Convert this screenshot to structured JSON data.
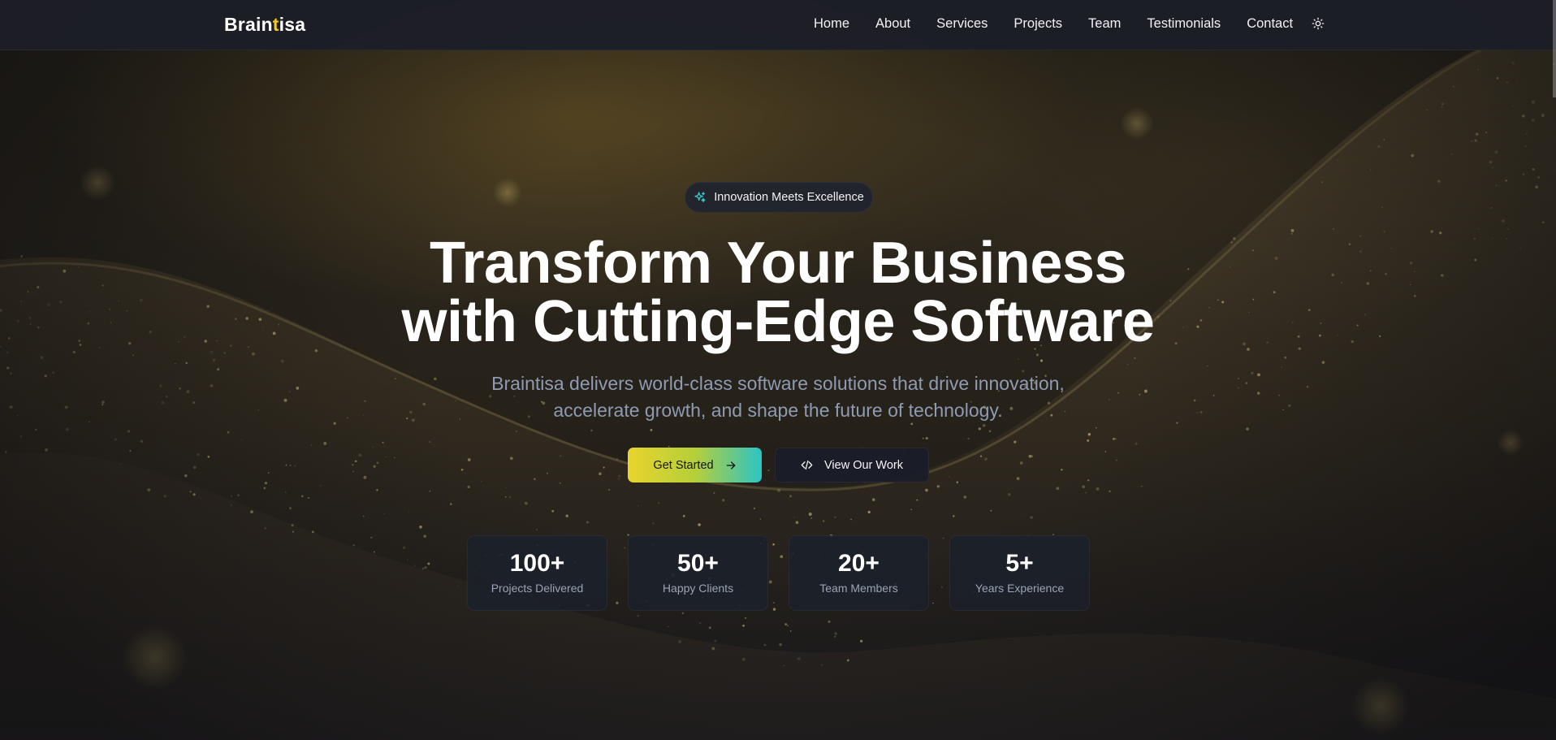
{
  "brand": {
    "name_start": "Brain",
    "name_accent": "t",
    "name_end": "isa",
    "accent_color": "#f1c82a"
  },
  "nav": {
    "links": [
      "Home",
      "About",
      "Services",
      "Projects",
      "Team",
      "Testimonials",
      "Contact"
    ],
    "theme_toggle_icon": "sun-icon"
  },
  "hero": {
    "badge": {
      "icon": "sparkles-icon",
      "text": "Innovation Meets Excellence"
    },
    "headline_line1": "Transform Your Business",
    "headline_line2": "with Cutting-Edge Software",
    "subtitle_line1": "Braintisa delivers world-class software solutions that drive innovation,",
    "subtitle_line2": "accelerate growth, and shape the future of technology.",
    "primary_button": {
      "label": "Get Started",
      "icon": "arrow-right-icon"
    },
    "secondary_button": {
      "label": "View Our Work",
      "icon": "code-icon"
    }
  },
  "stats": [
    {
      "value": "100+",
      "label": "Projects Delivered"
    },
    {
      "value": "50+",
      "label": "Happy Clients"
    },
    {
      "value": "20+",
      "label": "Team Members"
    },
    {
      "value": "5+",
      "label": "Years Experience"
    }
  ],
  "colors": {
    "gradient_start": "#e8d42c",
    "gradient_end": "#2cc4c4",
    "subtitle": "#8e9bb2"
  }
}
